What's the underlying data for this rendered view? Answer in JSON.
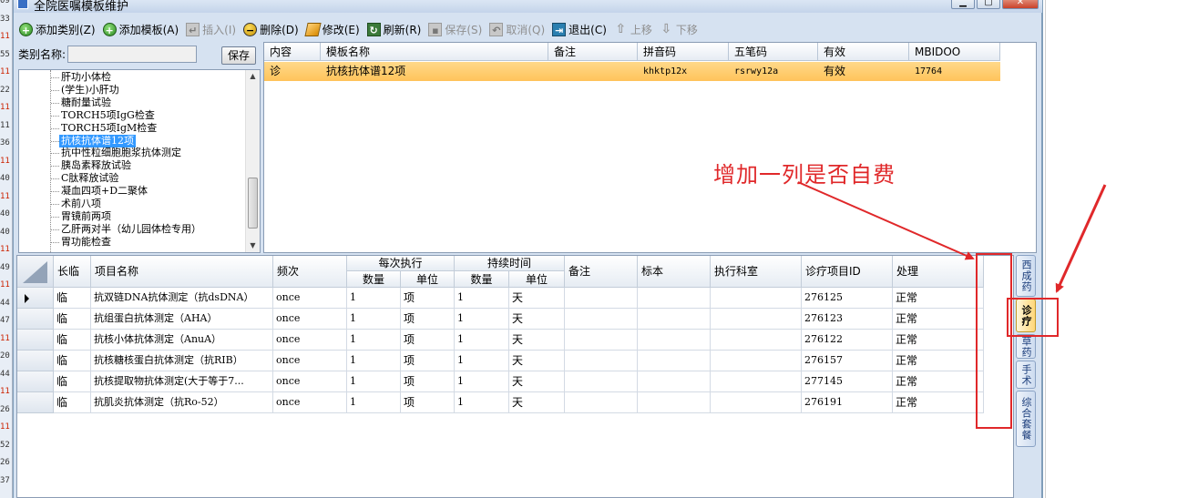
{
  "window": {
    "title": "全院医嘱模板维护"
  },
  "background_strip": {
    "lines": [
      {
        "text": "09",
        "red": false
      },
      {
        "text": "33",
        "red": false
      },
      {
        "text": "11",
        "red": true
      },
      {
        "text": "55",
        "red": false
      },
      {
        "text": "11",
        "red": true
      },
      {
        "text": "22",
        "red": false
      },
      {
        "text": "11",
        "red": true
      },
      {
        "text": "11",
        "red": false
      },
      {
        "text": "36",
        "red": false
      },
      {
        "text": "11",
        "red": true
      },
      {
        "text": "40",
        "red": false
      },
      {
        "text": "11",
        "red": true
      },
      {
        "text": "40",
        "red": false
      },
      {
        "text": "40",
        "red": false
      },
      {
        "text": "11",
        "red": true
      },
      {
        "text": "49",
        "red": false
      },
      {
        "text": "11",
        "red": true
      },
      {
        "text": "44",
        "red": false
      },
      {
        "text": "47",
        "red": false
      },
      {
        "text": "11",
        "red": true
      },
      {
        "text": "20",
        "red": false
      },
      {
        "text": "44",
        "red": false
      },
      {
        "text": "11",
        "red": true
      },
      {
        "text": "26",
        "red": false
      },
      {
        "text": "11",
        "red": true
      },
      {
        "text": "52",
        "red": false
      },
      {
        "text": "26",
        "red": false
      },
      {
        "text": "37",
        "red": false
      }
    ]
  },
  "toolbar": {
    "items": [
      {
        "label": "添加类别(Z)",
        "icon": "plus-icon",
        "glyph": "+",
        "style": "green",
        "enabled": true,
        "name": "add-category-button"
      },
      {
        "label": "添加模板(A)",
        "icon": "plus-icon",
        "glyph": "+",
        "style": "green",
        "enabled": true,
        "name": "add-template-button"
      },
      {
        "label": "插入(I)",
        "icon": "insert-icon",
        "glyph": "↵",
        "style": "gray",
        "enabled": false,
        "name": "insert-button"
      },
      {
        "label": "删除(D)",
        "icon": "minus-icon",
        "glyph": "−",
        "style": "black",
        "enabled": true,
        "name": "delete-button"
      },
      {
        "label": "修改(E)",
        "icon": "pencil-icon",
        "glyph": "",
        "style": "pencil",
        "enabled": true,
        "name": "edit-button"
      },
      {
        "label": "刷新(R)",
        "icon": "refresh-icon",
        "glyph": "↻",
        "style": "refresh",
        "enabled": true,
        "name": "refresh-button"
      },
      {
        "label": "保存(S)",
        "icon": "save-icon",
        "glyph": "▪",
        "style": "gray",
        "enabled": false,
        "name": "save-toolbar-button"
      },
      {
        "label": "取消(Q)",
        "icon": "undo-icon",
        "glyph": "↶",
        "style": "gray",
        "enabled": false,
        "name": "cancel-button"
      },
      {
        "label": "退出(C)",
        "icon": "exit-icon",
        "glyph": "⇥",
        "style": "exit",
        "enabled": true,
        "name": "exit-button"
      },
      {
        "label": "上移",
        "icon": "arrow-up-icon",
        "glyph": "⇧",
        "style": "arrow",
        "enabled": false,
        "name": "move-up-button"
      },
      {
        "label": "下移",
        "icon": "arrow-down-icon",
        "glyph": "⇩",
        "style": "arrow",
        "enabled": false,
        "name": "move-down-button"
      }
    ]
  },
  "category": {
    "label": "类别名称:",
    "value": "",
    "save_label": "保存"
  },
  "tree": {
    "items": [
      {
        "label": "肝功小体检",
        "selected": false
      },
      {
        "label": "(学生)小肝功",
        "selected": false
      },
      {
        "label": "糖耐量试验",
        "selected": false
      },
      {
        "label": "TORCH5项IgG检查",
        "selected": false
      },
      {
        "label": "TORCH5项IgM检查",
        "selected": false
      },
      {
        "label": "抗核抗体谱12项",
        "selected": true
      },
      {
        "label": "抗中性粒细胞胞浆抗体测定",
        "selected": false
      },
      {
        "label": "胰岛素释放试验",
        "selected": false
      },
      {
        "label": "C肽释放试验",
        "selected": false
      },
      {
        "label": "凝血四项+D二聚体",
        "selected": false
      },
      {
        "label": "术前八项",
        "selected": false
      },
      {
        "label": "胃镜前两项",
        "selected": false
      },
      {
        "label": "乙肝两对半（幼儿园体检专用）",
        "selected": false
      },
      {
        "label": "胃功能检查",
        "selected": false
      }
    ]
  },
  "template_grid": {
    "columns": [
      "内容",
      "模板名称",
      "备注",
      "拼音码",
      "五笔码",
      "有效",
      "MBIDOO"
    ],
    "rows": [
      [
        "诊",
        "抗核抗体谱12项",
        "",
        "khktp12x",
        "rsrwy12a",
        "有效",
        "17764"
      ]
    ]
  },
  "detail_grid": {
    "headers": {
      "long_temp": "长临",
      "item_name": "项目名称",
      "frequency": "频次",
      "per_exec": "每次执行",
      "per_exec_qty": "数量",
      "per_exec_unit": "单位",
      "duration": "持续时间",
      "duration_qty": "数量",
      "duration_unit": "单位",
      "remark": "备注",
      "specimen": "标本",
      "dept": "执行科室",
      "item_id": "诊疗项目ID",
      "handling": "处理"
    },
    "rows": [
      {
        "current": true,
        "type": "临",
        "name": "抗双链DNA抗体测定（抗dsDNA）",
        "freq": "once",
        "qty": "1",
        "unit": "项",
        "dqty": "1",
        "dunit": "天",
        "remark": "",
        "specimen": "",
        "dept": "",
        "id": "276125",
        "status": "正常"
      },
      {
        "current": false,
        "type": "临",
        "name": "抗组蛋白抗体测定（AHA）",
        "freq": "once",
        "qty": "1",
        "unit": "项",
        "dqty": "1",
        "dunit": "天",
        "remark": "",
        "specimen": "",
        "dept": "",
        "id": "276123",
        "status": "正常"
      },
      {
        "current": false,
        "type": "临",
        "name": "抗核小体抗体测定（AnuA）",
        "freq": "once",
        "qty": "1",
        "unit": "项",
        "dqty": "1",
        "dunit": "天",
        "remark": "",
        "specimen": "",
        "dept": "",
        "id": "276122",
        "status": "正常"
      },
      {
        "current": false,
        "type": "临",
        "name": "抗核糖核蛋白抗体测定（抗RIB）",
        "freq": "once",
        "qty": "1",
        "unit": "项",
        "dqty": "1",
        "dunit": "天",
        "remark": "",
        "specimen": "",
        "dept": "",
        "id": "276157",
        "status": "正常"
      },
      {
        "current": false,
        "type": "临",
        "name": "抗核提取物抗体测定(大于等于7...",
        "freq": "once",
        "qty": "1",
        "unit": "项",
        "dqty": "1",
        "dunit": "天",
        "remark": "",
        "specimen": "",
        "dept": "",
        "id": "277145",
        "status": "正常"
      },
      {
        "current": false,
        "type": "临",
        "name": "抗肌炎抗体测定（抗Ro-52）",
        "freq": "once",
        "qty": "1",
        "unit": "项",
        "dqty": "1",
        "dunit": "天",
        "remark": "",
        "specimen": "",
        "dept": "",
        "id": "276191",
        "status": "正常"
      }
    ]
  },
  "side_tabs": [
    {
      "label": "西成药",
      "active": false
    },
    {
      "label": "诊疗",
      "active": true
    },
    {
      "label": "草药",
      "active": false
    },
    {
      "label": "手术",
      "active": false
    },
    {
      "label": "综合套餐",
      "active": false
    }
  ],
  "annotation": {
    "text": "增加一列是否自费",
    "color": "#e0282a"
  },
  "colors": {
    "selection_row": "#ffc35a",
    "tree_selection": "#3399ff",
    "window_bg": "#d6e2f1",
    "annotation_red": "#e0282a"
  }
}
